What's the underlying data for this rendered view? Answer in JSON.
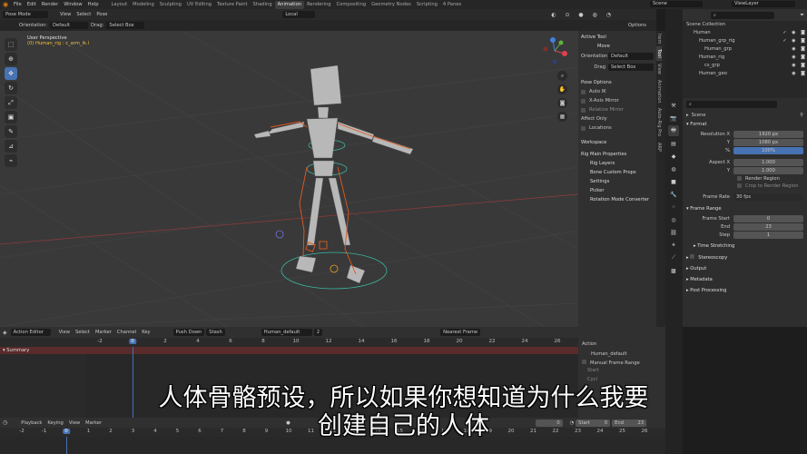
{
  "topbar": {
    "menus": [
      "File",
      "Edit",
      "Render",
      "Window",
      "Help"
    ],
    "workspaces": [
      "Layout",
      "Modeling",
      "Sculpting",
      "UV Editing",
      "Texture Paint",
      "Shading",
      "Animation",
      "Rendering",
      "Compositing",
      "Geometry Nodes",
      "Scripting",
      "4 Panes"
    ],
    "active_workspace": "Animation",
    "scene": "Scene",
    "view_layer": "ViewLayer"
  },
  "viewport_header": {
    "mode": "Pose Mode",
    "menus": [
      "View",
      "Select",
      "Pose"
    ],
    "transform_space": "Local",
    "orientation_label": "Orientation:",
    "orientation_value": "Default",
    "drag_label": "Drag:",
    "drag_value": "Select Box",
    "options": "Options"
  },
  "viewport": {
    "perspective": "User Perspective",
    "object_info": "(0) Human_rig : c_arm_ik.l"
  },
  "npanel": {
    "active_tool": "Active Tool",
    "move": "Move",
    "orientation_label": "Orientation",
    "orientation_value": "Default",
    "drag_label": "Drag",
    "drag_value": "Select Box",
    "pose_options": "Pose Options",
    "auto_ik": "Auto IK",
    "x_axis_mirror": "X-Axis Mirror",
    "relative_mirror": "Relative Mirror",
    "affect_only": "Affect Only",
    "locations": "Locations",
    "workspace": "Workspace",
    "rig_main_properties": "Rig Main Properties",
    "rig_layers": "Rig Layers",
    "bone_custom_props": "Bone Custom Props",
    "settings": "Settings",
    "picker": "Picker",
    "rotation_mode_converter": "Rotation Mode Converter",
    "tabs": [
      "Item",
      "Tool",
      "View",
      "Animation",
      "Auto-Rig Pro",
      "ARP"
    ]
  },
  "outliner": {
    "root": "Scene Collection",
    "items": [
      {
        "name": "Human",
        "indent": 1
      },
      {
        "name": "Human_grp_rig",
        "indent": 2
      },
      {
        "name": "Human_grp",
        "indent": 3
      },
      {
        "name": "Human_rig",
        "indent": 2
      },
      {
        "name": "cs_grp",
        "indent": 3
      },
      {
        "name": "Human_geo",
        "indent": 2
      }
    ]
  },
  "properties": {
    "scene_label": "Scene",
    "format": "Format",
    "resolution_x_label": "Resolution X",
    "resolution_x": "1920 px",
    "y_label": "Y",
    "resolution_y": "1080 px",
    "pct_label": "%",
    "resolution_pct": "100%",
    "aspect_x_label": "Aspect X",
    "aspect_x": "1.000",
    "aspect_y": "1.000",
    "render_region": "Render Region",
    "crop": "Crop to Render Region",
    "frame_rate_label": "Frame Rate",
    "frame_rate": "30 fps",
    "frame_range": "Frame Range",
    "frame_start_label": "Frame Start",
    "frame_start": "0",
    "end_label": "End",
    "end": "23",
    "step_label": "Step",
    "step": "1",
    "time_stretching": "Time Stretching",
    "stereoscopy": "Stereoscopy",
    "output": "Output",
    "metadata": "Metadata",
    "post_processing": "Post Processing"
  },
  "action_editor": {
    "mode": "Action Editor",
    "menus": [
      "View",
      "Select",
      "Marker",
      "Channel",
      "Key"
    ],
    "push_down": "Push Down",
    "stash": "Stash",
    "action_name": "Human_default",
    "users": "2",
    "snap": "Nearest Frame",
    "summary": "Summary",
    "ticks": [
      "-2",
      "0",
      "2",
      "4",
      "6",
      "8",
      "10",
      "12",
      "14",
      "16",
      "18",
      "20",
      "22",
      "24",
      "26"
    ],
    "current_frame": "0",
    "side": {
      "action": "Action",
      "name": "Human_default",
      "manual_frame_range": "Manual Frame Range",
      "start": "Start",
      "cyclic": "Cycl"
    }
  },
  "timeline": {
    "menus": [
      "Playback",
      "Keying",
      "View",
      "Marker"
    ],
    "current": "0",
    "start_label": "Start",
    "start": "0",
    "end_label": "End",
    "end": "23",
    "ticks": [
      "-2",
      "-1",
      "0",
      "1",
      "2",
      "3",
      "4",
      "5",
      "6",
      "7",
      "8",
      "9",
      "10",
      "11",
      "12",
      "13",
      "14",
      "15",
      "16",
      "17",
      "18",
      "19",
      "20",
      "21",
      "22",
      "23",
      "24",
      "25",
      "26"
    ]
  },
  "subtitle": {
    "line1": "人体骨骼预设，所以如果你想知道为什么我要",
    "line2": "创建自己的人体"
  },
  "colors": {
    "accent": "#4772b3",
    "summary_bar": "#5a2b2b",
    "active_bone": "#f0c040"
  }
}
